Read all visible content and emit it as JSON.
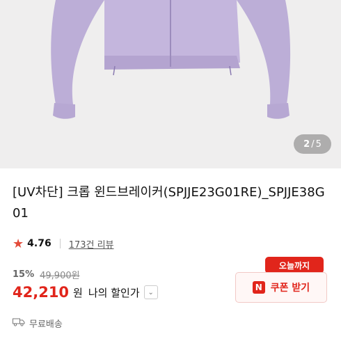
{
  "gallery": {
    "current": "2",
    "separator": "/",
    "total": "5"
  },
  "product": {
    "title": "[UV차단] 크롭 윈드브레이커(SPJJE23G01RE)_SPJJE38G01"
  },
  "rating": {
    "score": "4.76",
    "reviews": "173건 리뷰"
  },
  "pricing": {
    "discount": "15%",
    "original": "49,900원",
    "price": "42,210",
    "currency": "원",
    "my_sale": "나의 할인가"
  },
  "coupon": {
    "badge": "오늘까지",
    "icon_letter": "N",
    "label": "쿠폰 받기"
  },
  "shipping": {
    "label": "무료배송"
  },
  "colors": {
    "accent": "#e1251b",
    "jacket": "#c3b4dc"
  }
}
